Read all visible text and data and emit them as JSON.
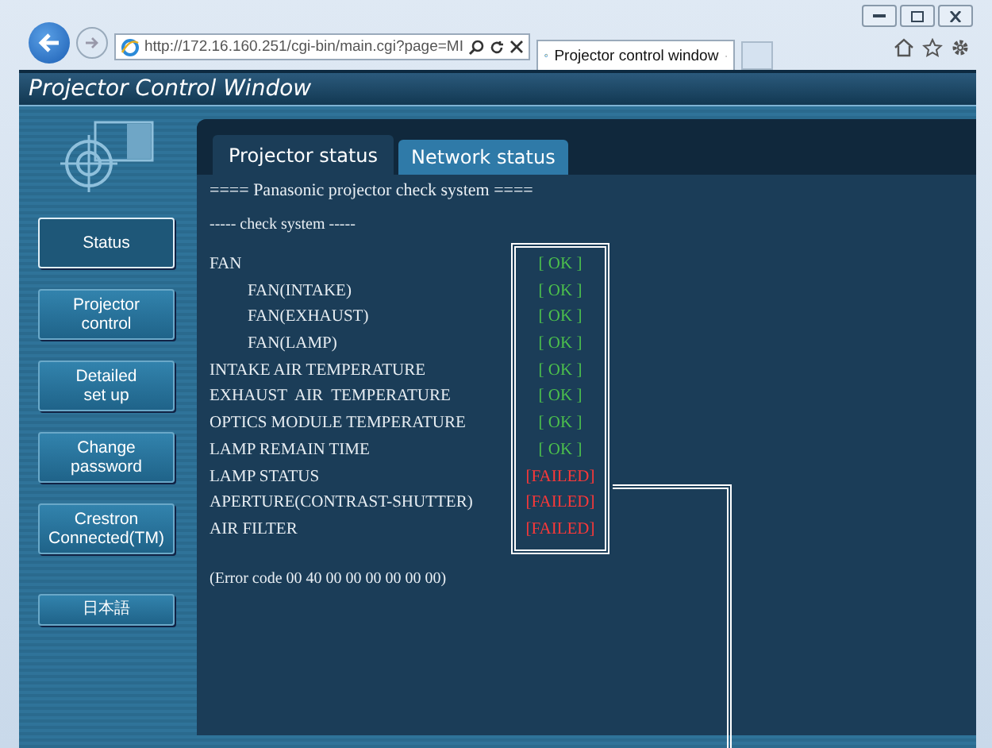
{
  "browser": {
    "address": "http://172.16.160.251/cgi-bin/main.cgi?page=MI",
    "tab_title": "Projector control window"
  },
  "window": {
    "title": "Projector Control Window"
  },
  "sidebar": {
    "items": [
      {
        "label": "Status",
        "selected": true
      },
      {
        "label": "Projector\ncontrol",
        "selected": false
      },
      {
        "label": "Detailed\nset up",
        "selected": false
      },
      {
        "label": "Change\npassword",
        "selected": false
      },
      {
        "label": "Crestron\nConnected(TM)",
        "selected": false
      },
      {
        "label": "日本語",
        "selected": false
      }
    ]
  },
  "tabs": [
    {
      "label": "Projector status",
      "selected": true
    },
    {
      "label": "Network status",
      "selected": false
    }
  ],
  "heading": "==== Panasonic projector check system ====",
  "subheading": "----- check system -----",
  "checks": [
    {
      "label": "FAN",
      "status": "[ OK ]",
      "kind": "ok",
      "children": [
        {
          "label": "FAN(INTAKE)",
          "status": "[ OK ]",
          "kind": "ok"
        },
        {
          "label": "FAN(EXHAUST)",
          "status": "[ OK ]",
          "kind": "ok"
        },
        {
          "label": "FAN(LAMP)",
          "status": "[ OK ]",
          "kind": "ok"
        }
      ]
    },
    {
      "label": "INTAKE AIR TEMPERATURE",
      "status": "[ OK ]",
      "kind": "ok"
    },
    {
      "label": "EXHAUST  AIR  TEMPERATURE",
      "status": "[ OK ]",
      "kind": "ok"
    },
    {
      "label": "OPTICS MODULE TEMPERATURE",
      "status": "[ OK ]",
      "kind": "ok"
    },
    {
      "label": "LAMP REMAIN TIME",
      "status": "[ OK ]",
      "kind": "ok"
    },
    {
      "label": "LAMP STATUS",
      "status": "[FAILED]",
      "kind": "failed"
    },
    {
      "label": "APERTURE(CONTRAST-SHUTTER)",
      "status": "[FAILED]",
      "kind": "failed"
    },
    {
      "label": "AIR FILTER",
      "status": "[FAILED]",
      "kind": "failed"
    }
  ],
  "error_code": "(Error code 00 40 00 00 00 00 00 00)"
}
